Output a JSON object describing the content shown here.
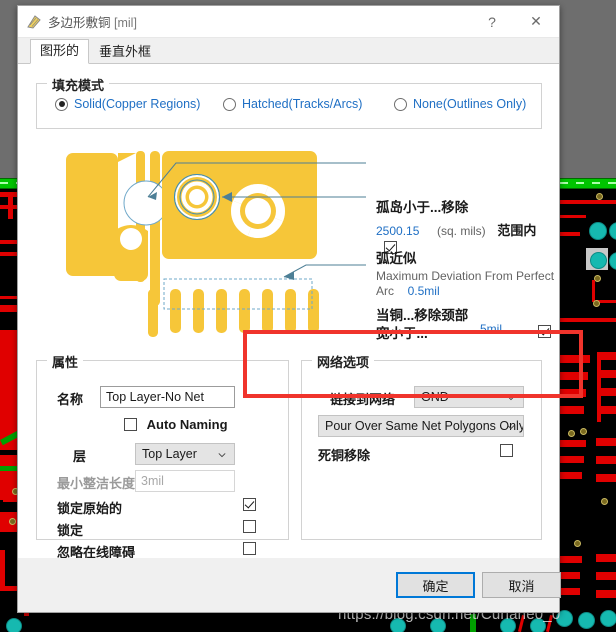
{
  "window": {
    "title": "多边形敷铜",
    "unit": "[mil]",
    "icon": "polygon-pour-icon",
    "help_label": "?",
    "close_label": "✕"
  },
  "tabs": [
    {
      "label": "图形的",
      "active": true
    },
    {
      "label": "垂直外框",
      "active": false
    }
  ],
  "fill_mode": {
    "group_title": "填充模式",
    "options": [
      {
        "label": "Solid(Copper Regions)",
        "selected": true
      },
      {
        "label": "Hatched(Tracks/Arcs)",
        "selected": false
      },
      {
        "label": "None(Outlines Only)",
        "selected": false
      }
    ]
  },
  "annotations": {
    "island": {
      "heading": "孤岛小于...移除",
      "value": "2500.15",
      "unit": "(sq. mils)",
      "scope_label": "范围内",
      "checked": true
    },
    "arc": {
      "heading": "弧近似",
      "sub_line1": "Maximum Deviation From Perfect",
      "sub_line2": "Arc",
      "value": "0.5mil"
    },
    "neck": {
      "heading_line1": "当铜...移除颈部",
      "heading_line2": "宽小于...",
      "value": "5mil",
      "checked": true
    }
  },
  "properties": {
    "group_title": "属性",
    "name_label": "名称",
    "name_value": "Top Layer-No Net",
    "auto_naming_label": "Auto Naming",
    "auto_naming_checked": false,
    "layer_label": "层",
    "layer_value": "Top Layer",
    "min_prim_label": "最小整洁长度",
    "min_prim_value": "3mil",
    "min_prim_disabled": true,
    "lock_primitives_label": "锁定原始的",
    "lock_primitives_checked": true,
    "locked_label": "锁定",
    "locked_checked": false,
    "ignore_obstacles_label": "忽略在线障碍",
    "ignore_obstacles_checked": false
  },
  "net_options": {
    "group_title": "网络选项",
    "connect_label": "链接到网络",
    "connect_value": "GND",
    "pour_over_value": "Pour Over Same Net Polygons Only",
    "remove_dead_label": "死铜移除",
    "remove_dead_checked": false
  },
  "footer": {
    "ok_label": "确定",
    "cancel_label": "取消"
  },
  "watermark": "https://blog.csdn.net/Curiane0_0",
  "colors": {
    "accent_blue": "#1f6fc4",
    "copper_yellow": "#f6c639",
    "annotation_red": "#f0342c",
    "focus_blue": "#0078d7",
    "pcb_trace_red": "#e00000",
    "pcb_pad_cyan": "#16b9b0",
    "pcb_green": "#00c400"
  }
}
